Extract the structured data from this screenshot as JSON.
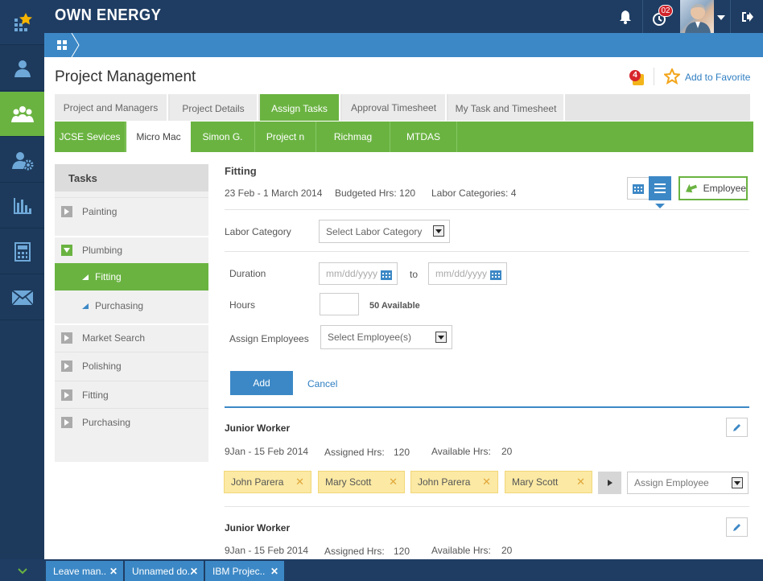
{
  "app": {
    "brand": "OWN ENERGY",
    "notification_count": "02"
  },
  "page": {
    "title": "Project Management",
    "fav_badge": "4",
    "add_favorite": "Add to Favorite"
  },
  "tabs1": [
    "Project and Managers",
    "Project Details",
    "Assign Tasks",
    "Approval Timesheet",
    "My Task and Timesheet"
  ],
  "tabs2": [
    "JCSE Sevices",
    "Micro Mac",
    "Simon G.",
    "Project n",
    "Richmag",
    "MTDAS"
  ],
  "tasks": {
    "heading": "Tasks",
    "items": [
      "Painting",
      "Plumbing",
      "Fitting",
      "Purchasing",
      "Market Search",
      "Polishing",
      "Fitting",
      "Purchasing"
    ]
  },
  "detail": {
    "title": "Fitting",
    "dates": "23 Feb  - 1 March 2014",
    "budgeted": "Budgeted Hrs: 120",
    "labor_categories": "Labor Categories: 4",
    "employee_btn": "Employee"
  },
  "form": {
    "labor_category_label": "Labor Category",
    "labor_category_value": "Select Labor Category",
    "duration_label": "Duration",
    "date_placeholder": "mm/dd/yyyy",
    "to": "to",
    "hours_label": "Hours",
    "hours_available": "50 Available",
    "assign_label": "Assign Employees",
    "assign_value": "Select Employee(s)",
    "add": "Add",
    "cancel": "Cancel"
  },
  "workers": [
    {
      "title": "Junior Worker",
      "dates": "9Jan  - 15 Feb 2014",
      "assigned_label": "Assigned Hrs:",
      "assigned": "120",
      "available_label": "Available Hrs:",
      "available": "20",
      "chips": [
        "John Parera",
        "Mary Scott",
        "John Parera",
        "Mary Scott"
      ],
      "assign_placeholder": "Assign Employee"
    },
    {
      "title": "Junior Worker",
      "dates": "9Jan  - 15 Feb 2014",
      "assigned_label": "Assigned Hrs:",
      "assigned": "120",
      "available_label": "Available Hrs:",
      "available": "20"
    }
  ],
  "bottom_tabs": [
    "Leave man..",
    "Unnamed do..",
    "IBM Projec.."
  ],
  "colors": {
    "green": "#6ab341",
    "navy": "#1f3d63",
    "blue": "#3c88c6",
    "chip": "#fbe9a4"
  }
}
